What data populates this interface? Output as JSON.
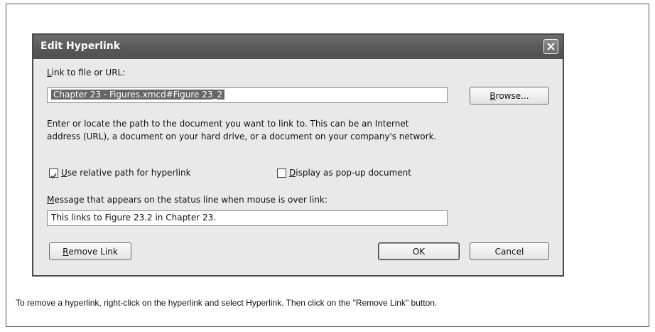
{
  "dialog": {
    "title": "Edit Hyperlink",
    "link_label_accel": "L",
    "link_label_rest": "ink to file or URL:",
    "link_value": "Chapter 23 - Figures.xmcd#Figure 23_2",
    "browse_accel": "B",
    "browse_rest": "rowse...",
    "help_line1": "Enter or locate the path to the document you want to link to. This can be an Internet",
    "help_line2": "address (URL), a document on your hard drive, or a document on your company's network.",
    "relative_path": {
      "accel": "U",
      "rest": "se relative path for hyperlink",
      "checked": true
    },
    "popup_doc": {
      "accel": "D",
      "rest": "isplay as pop-up document",
      "checked": false
    },
    "message_label_accel": "M",
    "message_label_rest": "essage that appears on the status line when mouse is over link:",
    "message_value": "This links to Figure 23.2 in Chapter 23.",
    "remove_link_accel": "R",
    "remove_link_rest": "emove Link",
    "ok_label": "OK",
    "cancel_label": "Cancel"
  },
  "caption": "To remove a hyperlink, right-click on the hyperlink and select Hyperlink. Then click on the \"Remove Link\" button."
}
